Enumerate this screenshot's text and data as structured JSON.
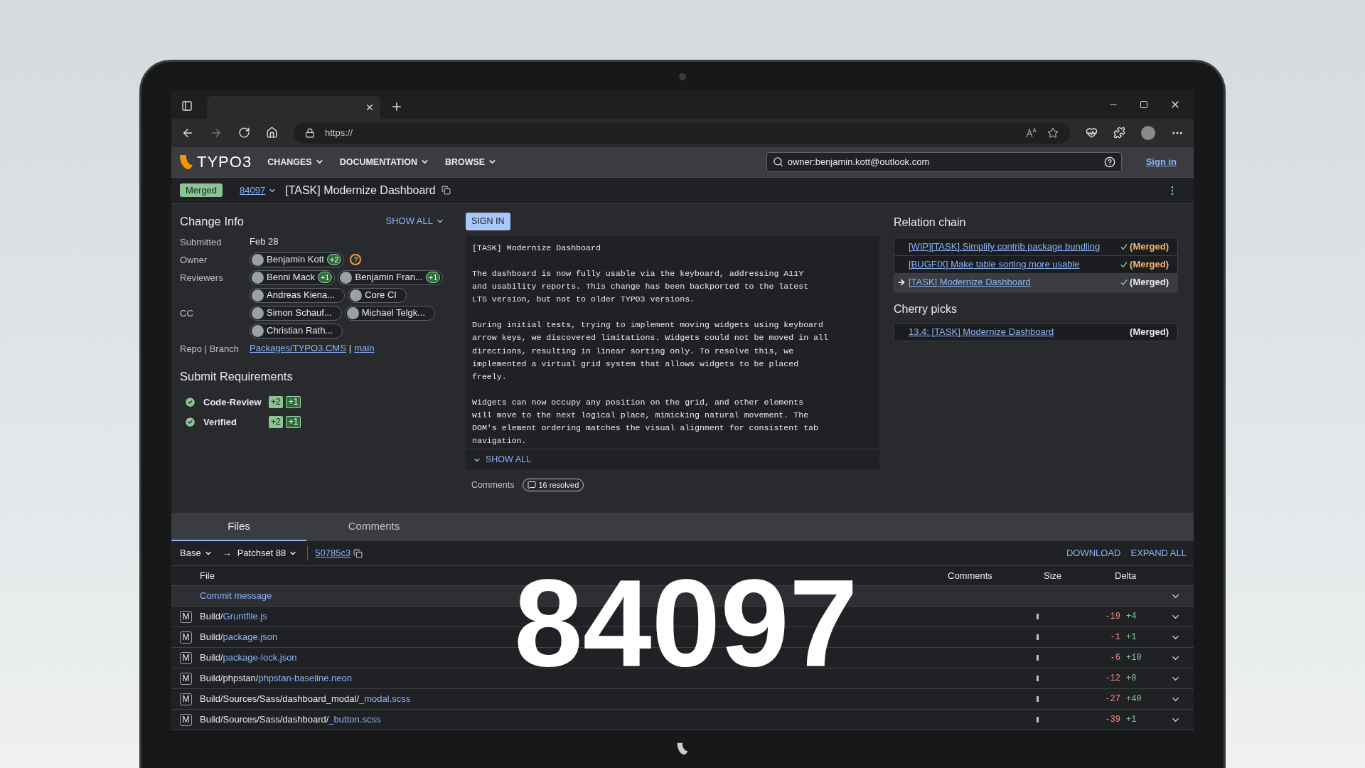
{
  "browser": {
    "url": "https://"
  },
  "header": {
    "logo": "TYPO3",
    "menus": [
      "CHANGES",
      "DOCUMENTATION",
      "BROWSE"
    ],
    "search": "owner:benjamin.kott@outlook.com",
    "sign_in": "Sign in"
  },
  "change": {
    "status": "Merged",
    "number": "84097",
    "title": "[TASK] Modernize Dashboard"
  },
  "change_info": {
    "title": "Change Info",
    "show_all": "SHOW ALL",
    "rows": [
      {
        "label": "Submitted",
        "kind": "text",
        "value": "Feb 28"
      },
      {
        "label": "Owner",
        "kind": "people",
        "people": [
          {
            "name": "Benjamin Kott",
            "vote": "+2"
          }
        ],
        "help": "?"
      },
      {
        "label": "Reviewers",
        "kind": "people",
        "people": [
          {
            "name": "Benni Mack",
            "vote": "+1"
          },
          {
            "name": "Benjamin Fran...",
            "vote": "+1"
          },
          {
            "name": "Andreas Kiena..."
          },
          {
            "name": "Core CI"
          }
        ]
      },
      {
        "label": "CC",
        "kind": "people",
        "people": [
          {
            "name": "Simon Schauf..."
          },
          {
            "name": "Michael Telgk..."
          },
          {
            "name": "Christian Rath..."
          }
        ]
      },
      {
        "label": "Repo | Branch",
        "kind": "links",
        "repo": "Packages/TYPO3.CMS",
        "sep": "|",
        "branch": "main"
      }
    ]
  },
  "submit_requirements": {
    "title": "Submit Requirements",
    "items": [
      {
        "name": "Code-Review",
        "satisfied": true,
        "votes": [
          "+2",
          "+1"
        ]
      },
      {
        "name": "Verified",
        "satisfied": true,
        "votes": [
          "+2",
          "+1"
        ]
      }
    ]
  },
  "commit": {
    "sign_in": "SIGN IN",
    "message": "[TASK] Modernize Dashboard\n\nThe dashboard is now fully usable via the keyboard, addressing A11Y\nand usability reports. This change has been backported to the latest\nLTS version, but not to older TYPO3 versions.\n\nDuring initial tests, trying to implement moving widgets using keyboard\narrow keys, we discovered limitations. Widgets could not be moved in all\ndirections, resulting in linear sorting only. To resolve this, we\nimplemented a virtual grid system that allows widgets to be placed\nfreely.\n\nWidgets can now occupy any position on the grid, and other elements\nwill move to the next logical place, mimicking natural movement. The\nDOM's element ordering matches the visual alignment for consistent tab\nnavigation.",
    "show_all": "SHOW ALL",
    "comments_label": "Comments",
    "comments_badge": "16 resolved"
  },
  "relation_chain": {
    "title": "Relation chain",
    "items": [
      {
        "title": "[WIP][TASK] Simplify contrib package bundling",
        "status": "(Merged)",
        "selected": false
      },
      {
        "title": "[BUGFIX] Make table sorting more usable",
        "status": "(Merged)",
        "selected": false
      },
      {
        "title": "[TASK] Modernize Dashboard",
        "status": "(Merged)",
        "selected": true
      }
    ]
  },
  "cherry_picks": {
    "title": "Cherry picks",
    "items": [
      {
        "title": "13.4: [TASK] Modernize Dashboard",
        "status": "(Merged)"
      }
    ]
  },
  "tabs": [
    {
      "label": "Files",
      "selected": true
    },
    {
      "label": "Comments",
      "selected": false
    }
  ],
  "files_toolbar": {
    "base": "Base",
    "arrow": "→",
    "patchset": "Patchset 88",
    "commit": "50785c3",
    "download": "DOWNLOAD",
    "expand_all": "EXPAND ALL"
  },
  "files": {
    "columns": [
      "File",
      "Comments",
      "Size",
      "Delta"
    ],
    "commit_message": "Commit message",
    "rows": [
      {
        "status": "M",
        "dir": "Build/",
        "name": "Gruntfile.js",
        "removed": "-19",
        "added": "+4"
      },
      {
        "status": "M",
        "dir": "Build/",
        "name": "package.json",
        "removed": "-1",
        "added": "+1"
      },
      {
        "status": "M",
        "dir": "Build/",
        "name": "package-lock.json",
        "removed": "-6",
        "added": "+10"
      },
      {
        "status": "M",
        "dir": "Build/phpstan/",
        "name": "phpstan-baseline.neon",
        "removed": "-12",
        "added": "+0"
      },
      {
        "status": "M",
        "dir": "Build/Sources/Sass/dashboard_modal/",
        "name": "_modal.scss",
        "removed": "-27",
        "added": "+40"
      },
      {
        "status": "M",
        "dir": "Build/Sources/Sass/dashboard/",
        "name": "_button.scss",
        "removed": "-39",
        "added": "+1"
      }
    ]
  },
  "overlay": "84097"
}
